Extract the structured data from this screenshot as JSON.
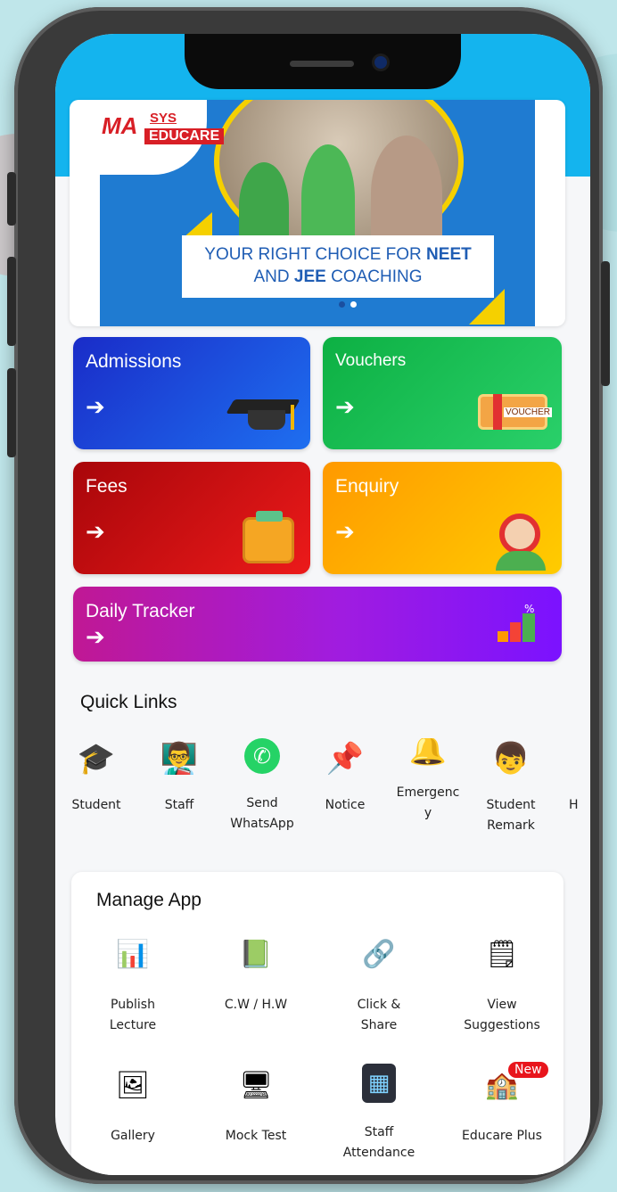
{
  "banner": {
    "logo_ma": "MA",
    "logo_sys": "SYS",
    "logo_educare": "EDUCARE",
    "text_line1_prefix": "YOUR RIGHT CHOICE FOR ",
    "text_line1_bold": "NEET",
    "text_line2_prefix": "AND ",
    "text_line2_bold": "JEE",
    "text_line2_suffix": " COACHING",
    "slide_count": 2,
    "active_slide": 2
  },
  "tiles": [
    {
      "title": "Admissions",
      "arrow": "➔",
      "icon": "graduation-cap-icon",
      "color": "#1a3fd0"
    },
    {
      "title": "Vouchers",
      "arrow": "➔",
      "icon": "voucher-icon",
      "color": "#14b33a",
      "icon_text": "VOUCHER"
    },
    {
      "title": "Fees",
      "arrow": "➔",
      "icon": "wallet-icon",
      "color": "#d10d12"
    },
    {
      "title": "Enquiry",
      "arrow": "➔",
      "icon": "support-agent-icon",
      "color": "#ffb400"
    },
    {
      "title": "Daily Tracker",
      "arrow": "➔",
      "icon": "growth-chart-icon",
      "color": "#a01ce0",
      "icon_text": "%"
    }
  ],
  "quick_links": {
    "title": "Quick Links",
    "items": [
      {
        "label": "Student",
        "icon": "student-icon",
        "glyph": "🎓"
      },
      {
        "label": "Staff",
        "icon": "staff-icon",
        "glyph": "👨‍🏫"
      },
      {
        "label": "Send\nWhatsApp",
        "icon": "whatsapp-icon",
        "glyph": "✆"
      },
      {
        "label": "Notice",
        "icon": "pushpin-icon",
        "glyph": "📌"
      },
      {
        "label": "Emergenc\ny\nCirculars",
        "icon": "alarm-bell-icon",
        "glyph": "🔔"
      },
      {
        "label": "Student\nRemark",
        "icon": "student-remark-icon",
        "glyph": "👦"
      },
      {
        "label": "H",
        "icon": "homework-icon",
        "glyph": ""
      }
    ]
  },
  "manage_app": {
    "title": "Manage App",
    "items": [
      {
        "label": "Publish\nLecture",
        "icon": "presentation-board-icon",
        "glyph": "📊"
      },
      {
        "label": "C.W / H.W",
        "icon": "notebook-icon",
        "glyph": "📗"
      },
      {
        "label": "Click &\nShare",
        "icon": "share-network-icon",
        "glyph": "🔗"
      },
      {
        "label": "View\nSuggestions",
        "icon": "sticky-notes-icon",
        "glyph": "🗒"
      },
      {
        "label": "Gallery",
        "icon": "gallery-icon",
        "glyph": "🖼"
      },
      {
        "label": "Mock Test",
        "icon": "mock-test-monitor-icon",
        "glyph": "🖥"
      },
      {
        "label": "Staff\nAttendance",
        "icon": "biometric-device-icon",
        "glyph": "▦"
      },
      {
        "label": "Educare Plus",
        "icon": "school-building-icon",
        "glyph": "🏫"
      }
    ],
    "new_badge": "New"
  }
}
